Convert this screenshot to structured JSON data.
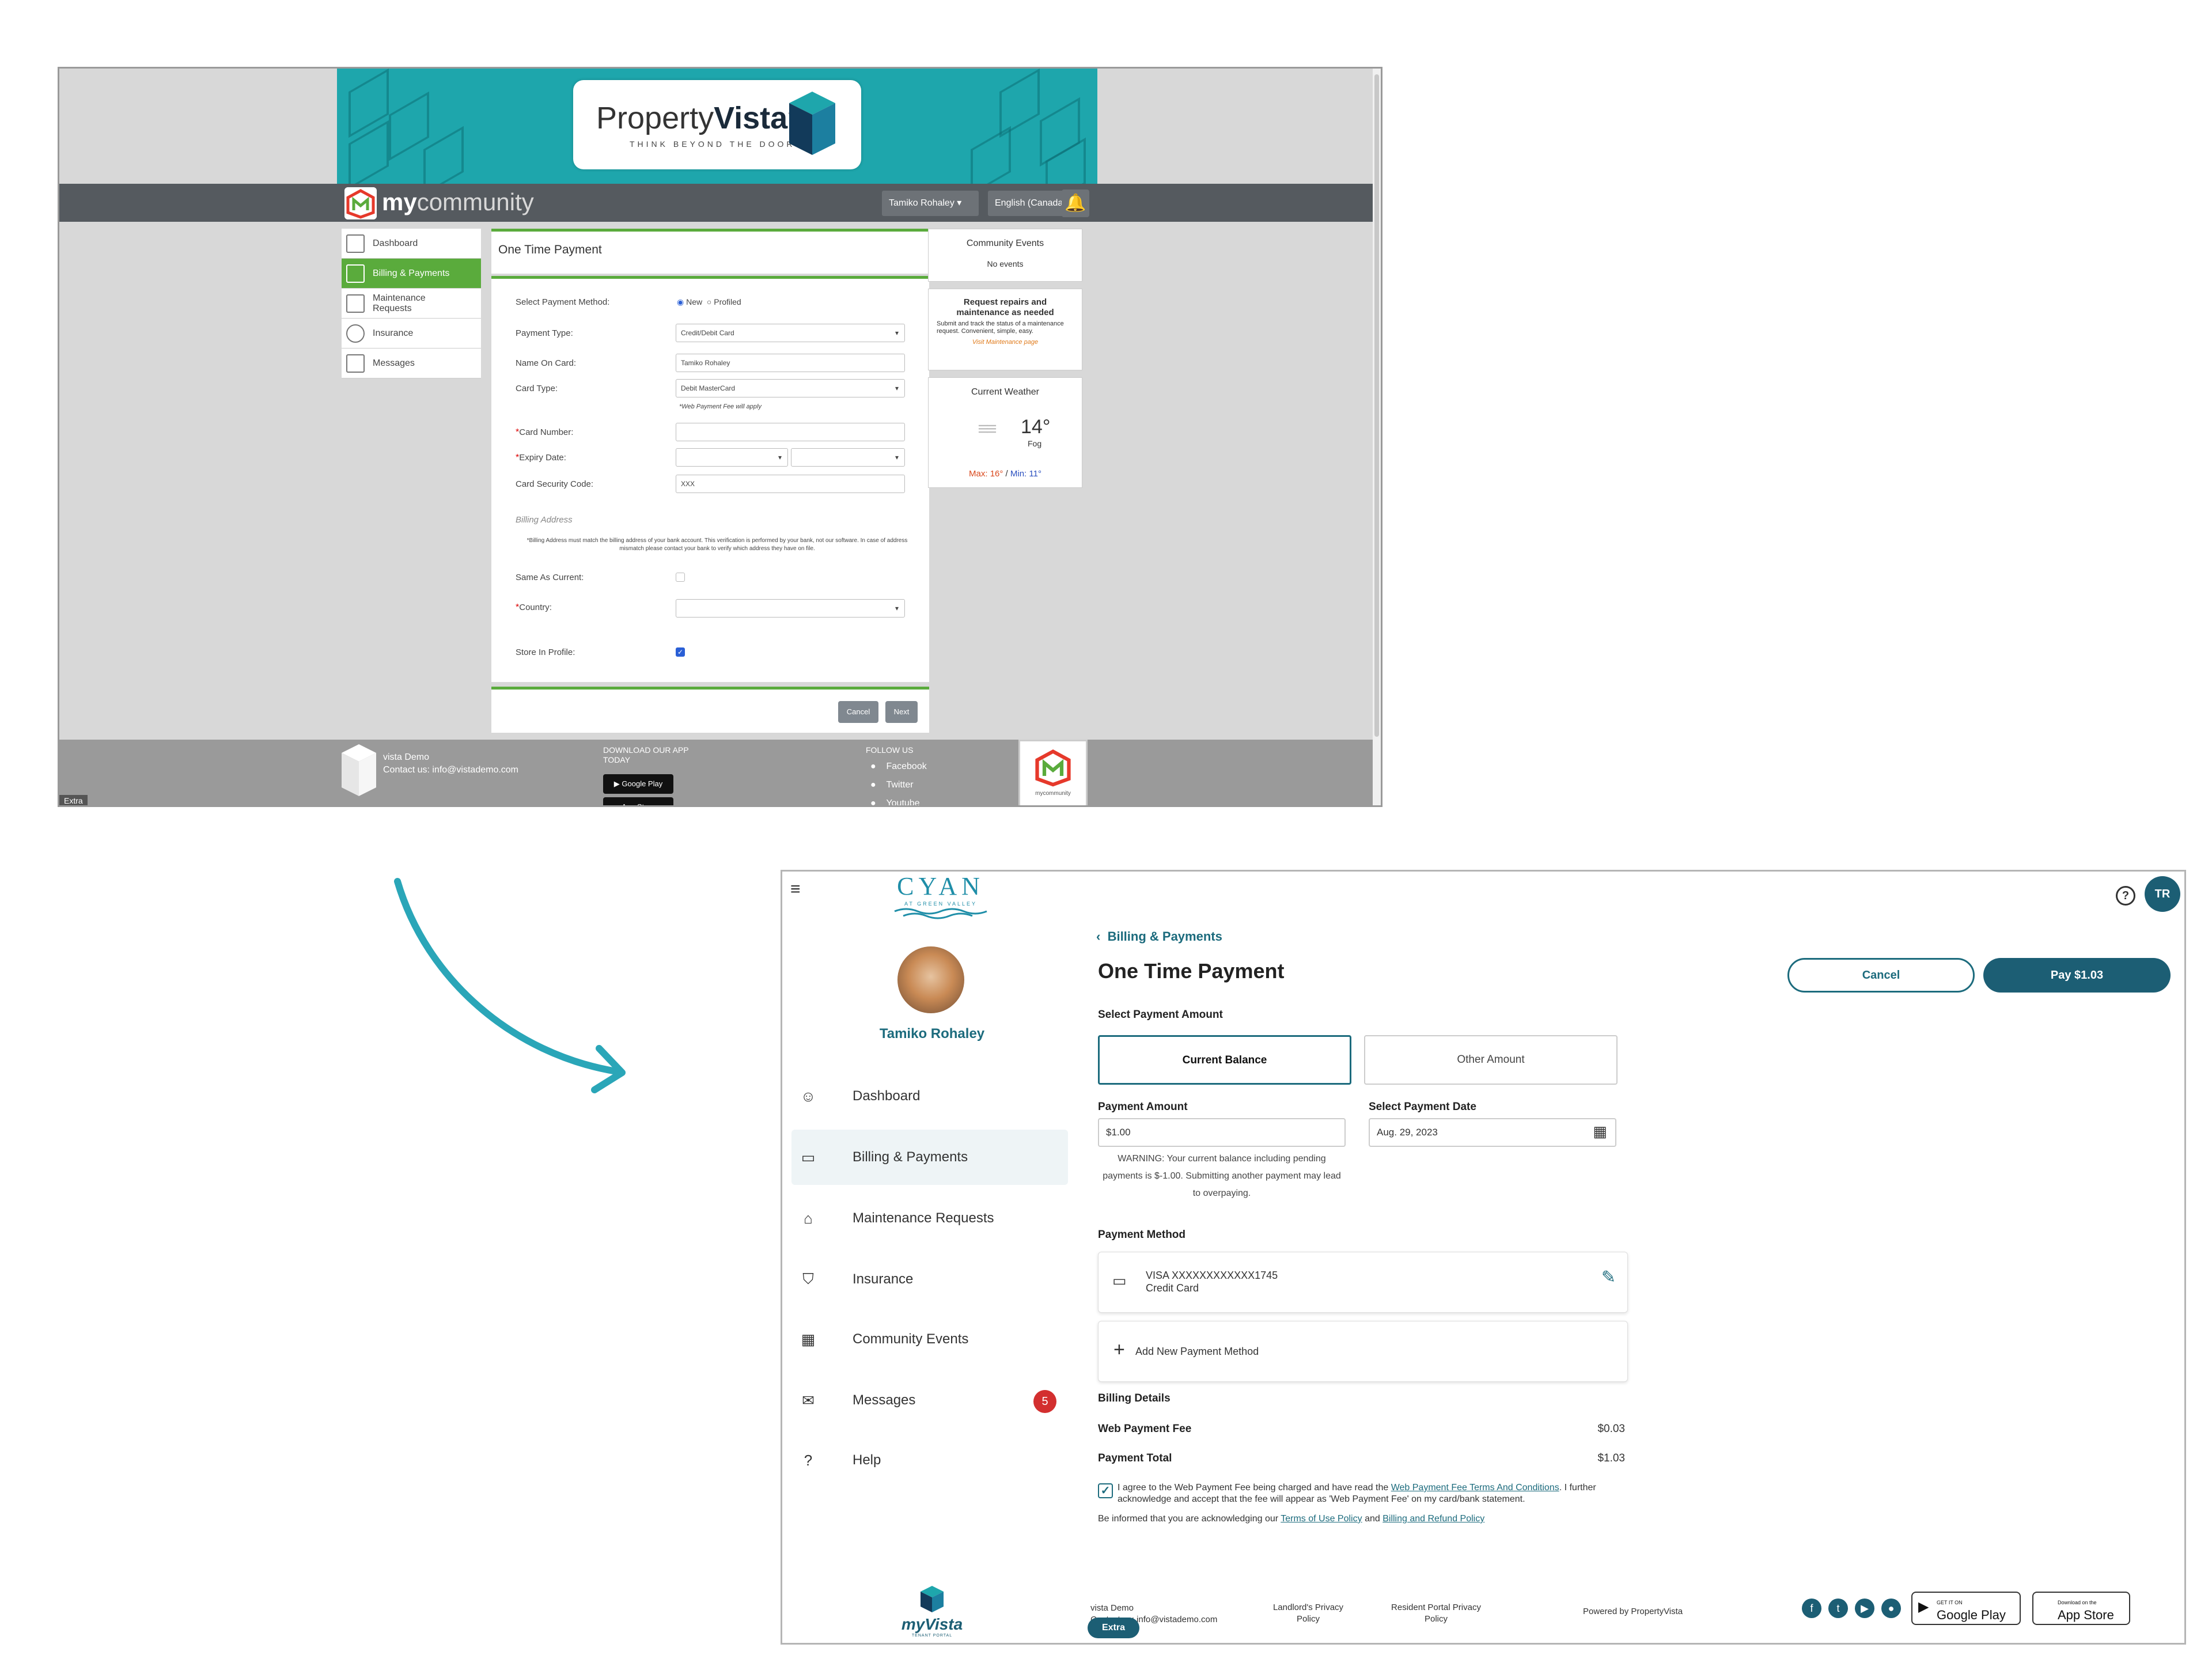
{
  "old_portal": {
    "brand_word_light": "Property",
    "brand_word_bold": "Vista",
    "brand_tm": "™",
    "tagline": "THINK BEYOND THE DOOR",
    "community_bold": "my",
    "community_light": "community",
    "user_select": "Tamiko Rohaley",
    "language_select": "English (Canada)",
    "sidebar": [
      {
        "label": "Dashboard"
      },
      {
        "label": "Billing & Payments",
        "active": true
      },
      {
        "label": "Maintenance Requests"
      },
      {
        "label": "Insurance"
      },
      {
        "label": "Messages"
      }
    ],
    "form": {
      "title": "One Time Payment",
      "payment_method_label": "Select Payment Method:",
      "method_new": "New",
      "method_profiled": "Profiled",
      "payment_type_label": "Payment Type:",
      "payment_type_value": "Credit/Debit Card",
      "name_on_card_label": "Name On Card:",
      "name_on_card_value": "Tamiko Rohaley",
      "card_type_label": "Card Type:",
      "card_type_value": "Debit MasterCard",
      "fee_note": "*Web Payment Fee will apply",
      "card_number_label": "Card Number:",
      "expiry_label": "Expiry Date:",
      "security_label": "Card Security Code:",
      "security_placeholder": "XXX",
      "billing_address_heading": "Billing Address",
      "billing_note": "*Billing Address must match the billing address of your bank account. This verification is performed by your bank, not our software. In case of address mismatch please contact your bank to verify which address they have on file.",
      "same_as_current_label": "Same As Current:",
      "country_label": "Country:",
      "store_in_profile_label": "Store In Profile:",
      "cancel_label": "Cancel",
      "next_label": "Next"
    },
    "community_events": {
      "title": "Community Events",
      "body": "No events"
    },
    "repairs": {
      "title": "Request repairs and maintenance as needed",
      "body": "Submit and track the status of a maintenance request. Convenient, simple, easy.",
      "link": "Visit Maintenance page"
    },
    "weather": {
      "title": "Current Weather",
      "temp": "14°",
      "condition": "Fog",
      "max_label": "Max: 16°",
      "min_label": "Min: 11°",
      "max_color": "#d9481c",
      "min_color": "#2a4fbf"
    },
    "footer": {
      "company": "vista Demo",
      "contact": "Contact us: info@vistademo.com",
      "download": "DOWNLOAD OUR APP TODAY",
      "google_play": "Google Play",
      "app_store": "App Store",
      "follow": "FOLLOW US",
      "facebook": "Facebook",
      "twitter": "Twitter",
      "youtube": "Youtube",
      "badge_text": "mycommunity",
      "extra": "Extra"
    }
  },
  "new_portal": {
    "logo_word": "CYAN",
    "logo_sub": "AT GREEN VALLEY",
    "user_name": "Tamiko Rohaley",
    "initials": "TR",
    "help_icon": "?",
    "nav": [
      {
        "label": "Dashboard",
        "icon": "dashboard-icon",
        "glyph": "☺"
      },
      {
        "label": "Billing & Payments",
        "icon": "credit-card-icon",
        "glyph": "▭",
        "active": true
      },
      {
        "label": "Maintenance Requests",
        "icon": "toolbox-icon",
        "glyph": "⌂"
      },
      {
        "label": "Insurance",
        "icon": "shield-icon",
        "glyph": "⛉"
      },
      {
        "label": "Community Events",
        "icon": "calendar-icon",
        "glyph": "▦"
      },
      {
        "label": "Messages",
        "icon": "message-icon",
        "glyph": "✉",
        "badge": "5"
      },
      {
        "label": "Help",
        "icon": "help-icon",
        "glyph": "?"
      }
    ],
    "breadcrumb": "Billing & Payments",
    "title": "One Time Payment",
    "cancel_label": "Cancel",
    "pay_label": "Pay $1.03",
    "select_amount_label": "Select Payment Amount",
    "current_balance_label": "Current Balance",
    "other_amount_label": "Other Amount",
    "payment_amount_label": "Payment Amount",
    "payment_amount_value": "$1.00",
    "payment_date_label": "Select Payment Date",
    "payment_date_value": "Aug. 29, 2023",
    "warning": "WARNING: Your current balance including pending payments is $-1.00. Submitting another payment may lead to overpaying.",
    "payment_method_label": "Payment Method",
    "card_number": "VISA XXXXXXXXXXXX1745",
    "card_kind": "Credit Card",
    "add_method_label": "Add New Payment Method",
    "billing_details_label": "Billing Details",
    "fee_label": "Web Payment Fee",
    "fee_value": "$0.03",
    "total_label": "Payment Total",
    "total_value": "$1.03",
    "agree_text_1": "I agree to the Web Payment Fee being charged and have read the",
    "agree_link": "Web Payment Fee Terms And Conditions",
    "agree_text_2": ". I further acknowledge and accept that the fee will appear as 'Web Payment Fee' on my card/bank statement.",
    "inform_text": "Be informed that you are acknowledging our",
    "terms_link": "Terms of Use Policy",
    "and_text": "and",
    "refund_link": "Billing and Refund Policy",
    "footer": {
      "brand": "myVista",
      "brand_sub": "TENANT PORTAL",
      "company": "vista Demo",
      "contact": "Contact us: info@vistademo.com",
      "landlord_privacy": "Landlord's Privacy Policy",
      "resident_privacy": "Resident Portal Privacy Policy",
      "powered_by": "Powered by PropertyVista",
      "google_play_small": "GET IT ON",
      "google_play": "Google Play",
      "app_store_small": "Download on the",
      "app_store": "App Store",
      "extra": "Extra"
    }
  },
  "colors": {
    "old_accent": "#5aab3c",
    "old_banner": "#1ea6ac",
    "new_accent": "#1c6b7d",
    "badge_red": "#d32f2f",
    "arrow": "#2aa6b8"
  }
}
